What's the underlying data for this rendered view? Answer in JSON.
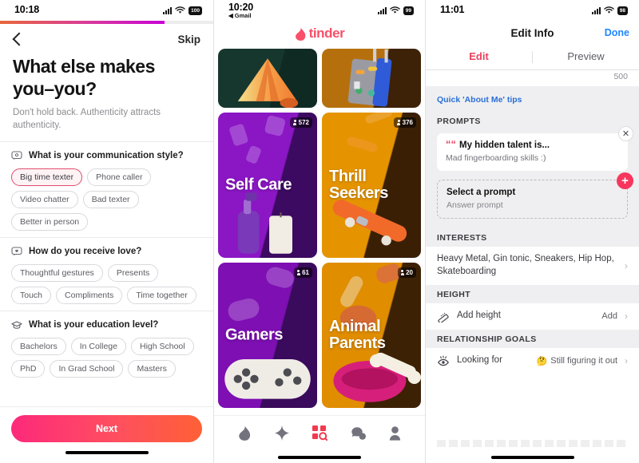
{
  "panel1": {
    "status": {
      "time": "10:18",
      "battery": "100",
      "signal_icon": "signal-bars-icon",
      "wifi_icon": "wifi-icon"
    },
    "progress_percent": 77,
    "back_icon": "back-chevron-icon",
    "skip_label": "Skip",
    "title": "What else makes you–you?",
    "subtitle": "Don't hold back. Authenticity attracts authenticity.",
    "questions": [
      {
        "icon": "speech-bubble-icon",
        "title": "What is your communication style?",
        "options": [
          {
            "label": "Big time texter",
            "selected": true
          },
          {
            "label": "Phone caller",
            "selected": false
          },
          {
            "label": "Video chatter",
            "selected": false
          },
          {
            "label": "Bad texter",
            "selected": false
          },
          {
            "label": "Better in person",
            "selected": false
          }
        ]
      },
      {
        "icon": "heart-bubble-icon",
        "title": "How do you receive love?",
        "options": [
          {
            "label": "Thoughtful gestures",
            "selected": false
          },
          {
            "label": "Presents",
            "selected": false
          },
          {
            "label": "Touch",
            "selected": false
          },
          {
            "label": "Compliments",
            "selected": false
          },
          {
            "label": "Time together",
            "selected": false
          }
        ]
      },
      {
        "icon": "graduation-cap-icon",
        "title": "What is your education level?",
        "options": [
          {
            "label": "Bachelors",
            "selected": false
          },
          {
            "label": "In College",
            "selected": false
          },
          {
            "label": "High School",
            "selected": false
          },
          {
            "label": "PhD",
            "selected": false
          },
          {
            "label": "In Grad School",
            "selected": false
          },
          {
            "label": "Masters",
            "selected": false
          }
        ]
      }
    ],
    "next_label": "Next",
    "accent_selected": "#e24a6e",
    "cta_gradient_from": "#fd297b",
    "cta_gradient_to": "#ff6036"
  },
  "panel2": {
    "status": {
      "time": "10:20",
      "back_app": "Gmail",
      "battery": "99",
      "signal_icon": "signal-bars-icon",
      "wifi_icon": "wifi-icon"
    },
    "logo_text": "tinder",
    "logo_icon": "tinder-flame-icon",
    "logo_color": "#fa4f69",
    "cards": [
      {
        "label": "",
        "count": "",
        "kind": "image-tent",
        "size": "small",
        "bg_a": "#16372e",
        "bg_b": "#0f2a23"
      },
      {
        "label": "",
        "count": "",
        "kind": "image-suitcase",
        "size": "small",
        "bg_a": "#b5700d",
        "bg_b": "#3d2208"
      },
      {
        "label": "Self Care",
        "count": "572",
        "kind": "image-selfcare",
        "size": "big",
        "bg_a": "#8a16c4",
        "bg_b": "#3c0a61"
      },
      {
        "label": "Thrill Seekers",
        "count": "376",
        "kind": "image-skate",
        "size": "big",
        "bg_a": "#e59400",
        "bg_b": "#3b1f05"
      },
      {
        "label": "Gamers",
        "count": "61",
        "kind": "image-gamepad",
        "size": "big",
        "bg_a": "#7d0fb3",
        "bg_b": "#3a0a5c"
      },
      {
        "label": "Animal Parents",
        "count": "20",
        "kind": "image-bowl",
        "size": "big",
        "bg_a": "#e08d00",
        "bg_b": "#3d2105"
      }
    ],
    "tabs": [
      {
        "icon": "flame-icon",
        "active": false
      },
      {
        "icon": "spark-star-icon",
        "active": false
      },
      {
        "icon": "explore-grid-search-icon",
        "active": true
      },
      {
        "icon": "chat-bubbles-icon",
        "active": false
      },
      {
        "icon": "profile-person-icon",
        "active": false
      }
    ],
    "active_tab_color": "#f2394f"
  },
  "panel3": {
    "status": {
      "time": "11:01",
      "battery": "98",
      "signal_icon": "signal-bars-icon",
      "wifi_icon": "wifi-icon"
    },
    "nav_title": "Edit Info",
    "done_label": "Done",
    "tabs": [
      {
        "label": "Edit",
        "active": true
      },
      {
        "label": "Preview",
        "active": false
      }
    ],
    "char_counter": "500",
    "tips_link": "Quick 'About Me' tips",
    "prompts": {
      "section_title": "PROMPTS",
      "answered": {
        "question": "My hidden talent is...",
        "answer": "Mad fingerboarding skills :)",
        "close_icon": "close-x-icon"
      },
      "empty": {
        "title": "Select a prompt",
        "subtitle": "Answer prompt",
        "add_icon": "plus-circle-icon"
      }
    },
    "interests": {
      "section_title": "INTERESTS",
      "value": "Heavy Metal, Gin tonic, Sneakers, Hip Hop, Skateboarding",
      "chevron_icon": "chevron-right-icon"
    },
    "height": {
      "section_title": "HEIGHT",
      "icon": "ruler-icon",
      "label": "Add height",
      "action": "Add",
      "chevron_icon": "chevron-right-icon"
    },
    "relationship": {
      "section_title": "RELATIONSHIP GOALS",
      "icon": "eye-icon",
      "label": "Looking for",
      "value_emoji": "🤔",
      "value": "Still figuring it out",
      "chevron_icon": "chevron-right-icon"
    },
    "tab_active_color": "#e8415d",
    "done_color": "#1f86ff",
    "link_color": "#2a6fd6"
  }
}
